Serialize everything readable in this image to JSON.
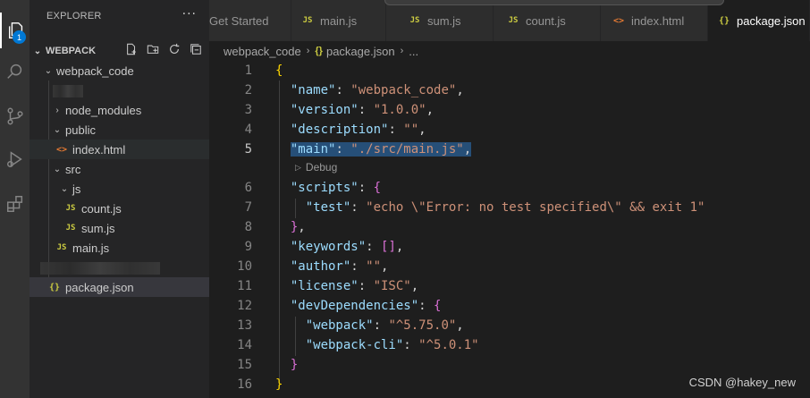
{
  "sidebar": {
    "title": "EXPLORER",
    "more": "···",
    "section": "WEBPACK",
    "tree": [
      {
        "label": "webpack_code"
      },
      {
        "label": "node_modules"
      },
      {
        "label": "public"
      },
      {
        "label": "index.html"
      },
      {
        "label": "src"
      },
      {
        "label": "js"
      },
      {
        "label": "count.js"
      },
      {
        "label": "sum.js"
      },
      {
        "label": "main.js"
      },
      {
        "label": "package.json"
      }
    ]
  },
  "activity": {
    "badge": "1"
  },
  "tabs": [
    {
      "label": "Get Started"
    },
    {
      "label": "main.js"
    },
    {
      "label": "sum.js"
    },
    {
      "label": "count.js"
    },
    {
      "label": "index.html"
    },
    {
      "label": "package.json"
    }
  ],
  "icons": {
    "js": "JS",
    "html": "<>",
    "json": "{}"
  },
  "breadcrumb": {
    "folder": "webpack_code",
    "file": "package.json",
    "tail": "..."
  },
  "editor": {
    "codelens": "Debug",
    "lines": [
      {
        "n": "1"
      },
      {
        "n": "2"
      },
      {
        "n": "3"
      },
      {
        "n": "4"
      },
      {
        "n": "5"
      },
      {
        "n": "6"
      },
      {
        "n": "7"
      },
      {
        "n": "8"
      },
      {
        "n": "9"
      },
      {
        "n": "10"
      },
      {
        "n": "11"
      },
      {
        "n": "12"
      },
      {
        "n": "13"
      },
      {
        "n": "14"
      },
      {
        "n": "15"
      },
      {
        "n": "16"
      }
    ],
    "tokens": {
      "l2k": "\"name\"",
      "l2v": "\"webpack_code\"",
      "l3k": "\"version\"",
      "l3v": "\"1.0.0\"",
      "l4k": "\"description\"",
      "l4v": "\"\"",
      "l5k": "\"main\"",
      "l5v": "\"./src/main.js\"",
      "l6k": "\"scripts\"",
      "l7k": "\"test\"",
      "l7v": "\"echo \\\"Error: no test specified\\\" && exit 1\"",
      "l9k": "\"keywords\"",
      "l10k": "\"author\"",
      "l10v": "\"\"",
      "l11k": "\"license\"",
      "l11v": "\"ISC\"",
      "l12k": "\"devDependencies\"",
      "l13k": "\"webpack\"",
      "l13v": "\"^5.75.0\"",
      "l14k": "\"webpack-cli\"",
      "l14v": "\"^5.0.1\""
    }
  },
  "watermark": "CSDN @hakey_new"
}
